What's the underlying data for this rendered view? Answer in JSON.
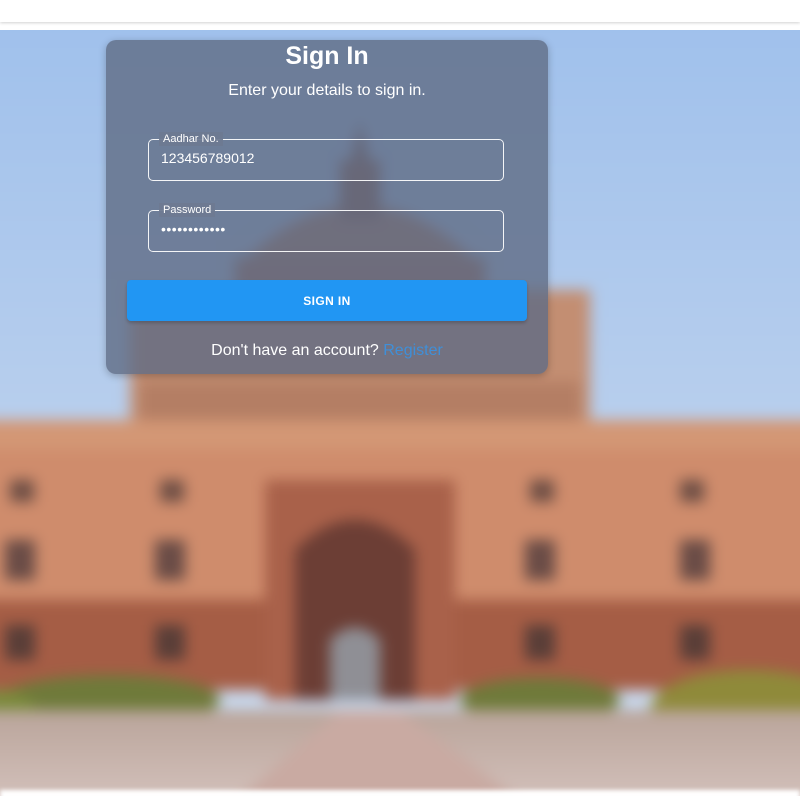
{
  "signin": {
    "title": "Sign In",
    "subtitle": "Enter your details to sign in.",
    "aadhar": {
      "label": "Aadhar No.",
      "value": "123456789012"
    },
    "password": {
      "label": "Password",
      "value": "••••••••••••"
    },
    "button_label": "SIGN IN",
    "footer_text": "Don't have an account? ",
    "footer_link": "Register"
  },
  "colors": {
    "primary_button": "#2196f3",
    "link": "#3f8fd8",
    "card": "#5f6c84"
  }
}
